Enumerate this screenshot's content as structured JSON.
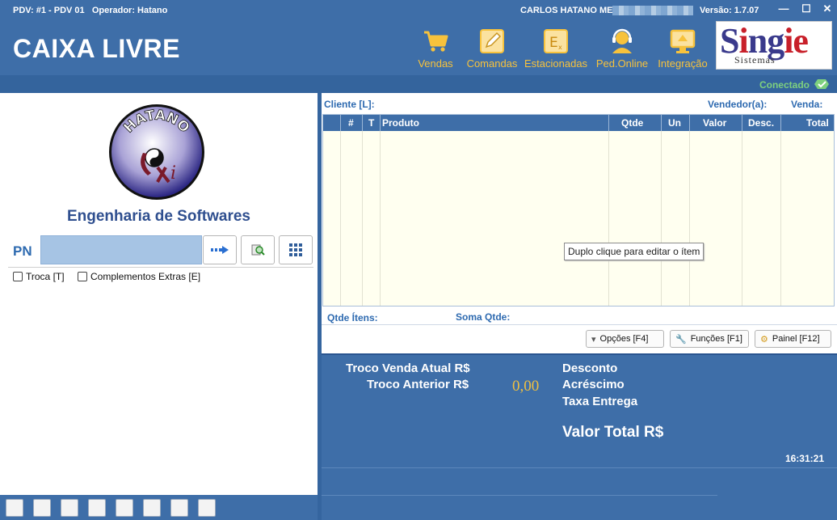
{
  "titlebar": {
    "pdv_info": "PDV: #1 - PDV 01",
    "operator": "Operador: Hatano",
    "user_name": "CARLOS HATANO ME",
    "version": "Versão: 1.7.07",
    "minimize": "—",
    "maximize": "☐",
    "close": "✕"
  },
  "header": {
    "title": "CAIXA LIVRE",
    "nav": [
      {
        "label": "Vendas",
        "icon": "cart-icon"
      },
      {
        "label": "Comandas",
        "icon": "edit-note-icon"
      },
      {
        "label": "Estacionadas",
        "icon": "parked-sale-icon"
      },
      {
        "label": "Ped.Online",
        "icon": "headset-user-icon"
      },
      {
        "label": "Integração",
        "icon": "monitor-integration-icon"
      }
    ],
    "logo_brand": "Singie",
    "logo_sub": "Sistemas"
  },
  "status": {
    "connection": "Conectado"
  },
  "left": {
    "seal_text": "HATANO",
    "company": "Engenharia de Softwares",
    "pn_label": "PN",
    "pn_value": "",
    "checkbox_troca": "Troca [T]",
    "checkbox_complementos": "Complementos Extras [E]"
  },
  "right": {
    "cliente_label": "Cliente [L]:",
    "vendedor_label": "Vendedor(a):",
    "venda_label": "Venda:",
    "columns": [
      "#",
      "T",
      "Produto",
      "Qtde",
      "Un",
      "Valor",
      "Desc.",
      "Total"
    ],
    "rows": [],
    "tooltip": "Duplo clique para editar o ítem",
    "qtde_itens_label": "Qtde Ítens:",
    "soma_qtde_label": "Soma Qtde:",
    "btn_opcoes": "Opções [F4]",
    "btn_funcoes": "Funções [F1]",
    "btn_painel": "Painel [F12]"
  },
  "totals": {
    "troco_atual_label": "Troco Venda Atual R$",
    "troco_anterior_label": "Troco Anterior R$",
    "troco_value": "0,00",
    "desconto_label": "Desconto",
    "acrescimo_label": "Acréscimo",
    "taxa_entrega_label": "Taxa Entrega",
    "valor_total_label": "Valor Total R$",
    "clock": "16:31:21"
  },
  "colors": {
    "primary_blue": "#3e6ea8",
    "accent_yellow": "#f7c23c",
    "connected_green": "#7ed07e",
    "pn_input_bg": "#a6c4e4"
  }
}
